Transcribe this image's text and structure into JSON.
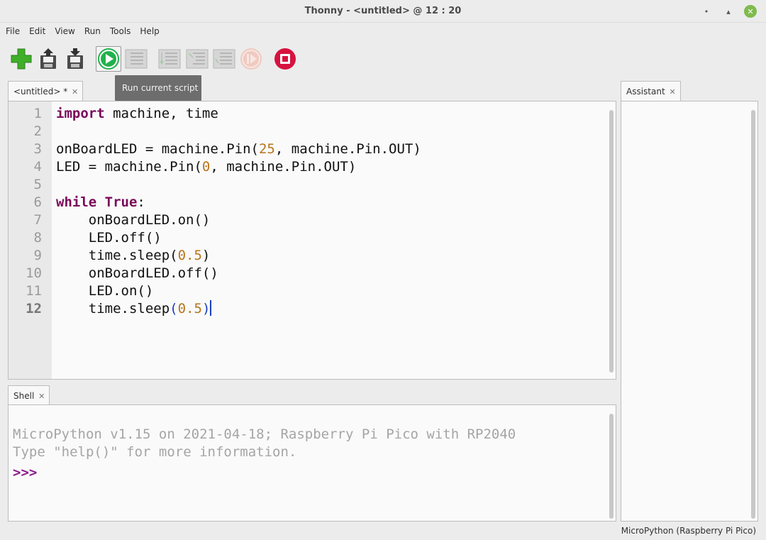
{
  "window": {
    "title": "Thonny - <untitled> @ 12 : 20",
    "minimize": "•",
    "maximize": "▴",
    "close": "✕"
  },
  "menu": [
    "File",
    "Edit",
    "View",
    "Run",
    "Tools",
    "Help"
  ],
  "toolbar": {
    "buttons": [
      "new-file",
      "load",
      "save",
      "run",
      "debug",
      "step-over",
      "step-into",
      "step-out",
      "resume",
      "stop"
    ],
    "tooltip": "Run current script",
    "colors": {
      "new": "#3fae29",
      "run": "#22b14c",
      "stop": "#d7123f",
      "disabled": "#b5b5b5"
    }
  },
  "editor": {
    "tab_label": "<untitled> *",
    "tab_close": "✕",
    "current_line": 12,
    "lines": [
      "import machine, time",
      "",
      "onBoardLED = machine.Pin(25, machine.Pin.OUT)",
      "LED = machine.Pin(0, machine.Pin.OUT)",
      "",
      "while True:",
      "    onBoardLED.on()",
      "    LED.off()",
      "    time.sleep(0.5)",
      "    onBoardLED.off()",
      "    LED.on()",
      "    time.sleep(0.5)"
    ]
  },
  "shell": {
    "tab_label": "Shell",
    "tab_close": "✕",
    "banner_line1": "MicroPython v1.15 on 2021-04-18; Raspberry Pi Pico with RP2040",
    "banner_line2": "Type \"help()\" for more information.",
    "prompt": ">>>"
  },
  "assistant": {
    "tab_label": "Assistant",
    "tab_close": "✕"
  },
  "status": {
    "interpreter": "MicroPython (Raspberry Pi Pico)"
  }
}
